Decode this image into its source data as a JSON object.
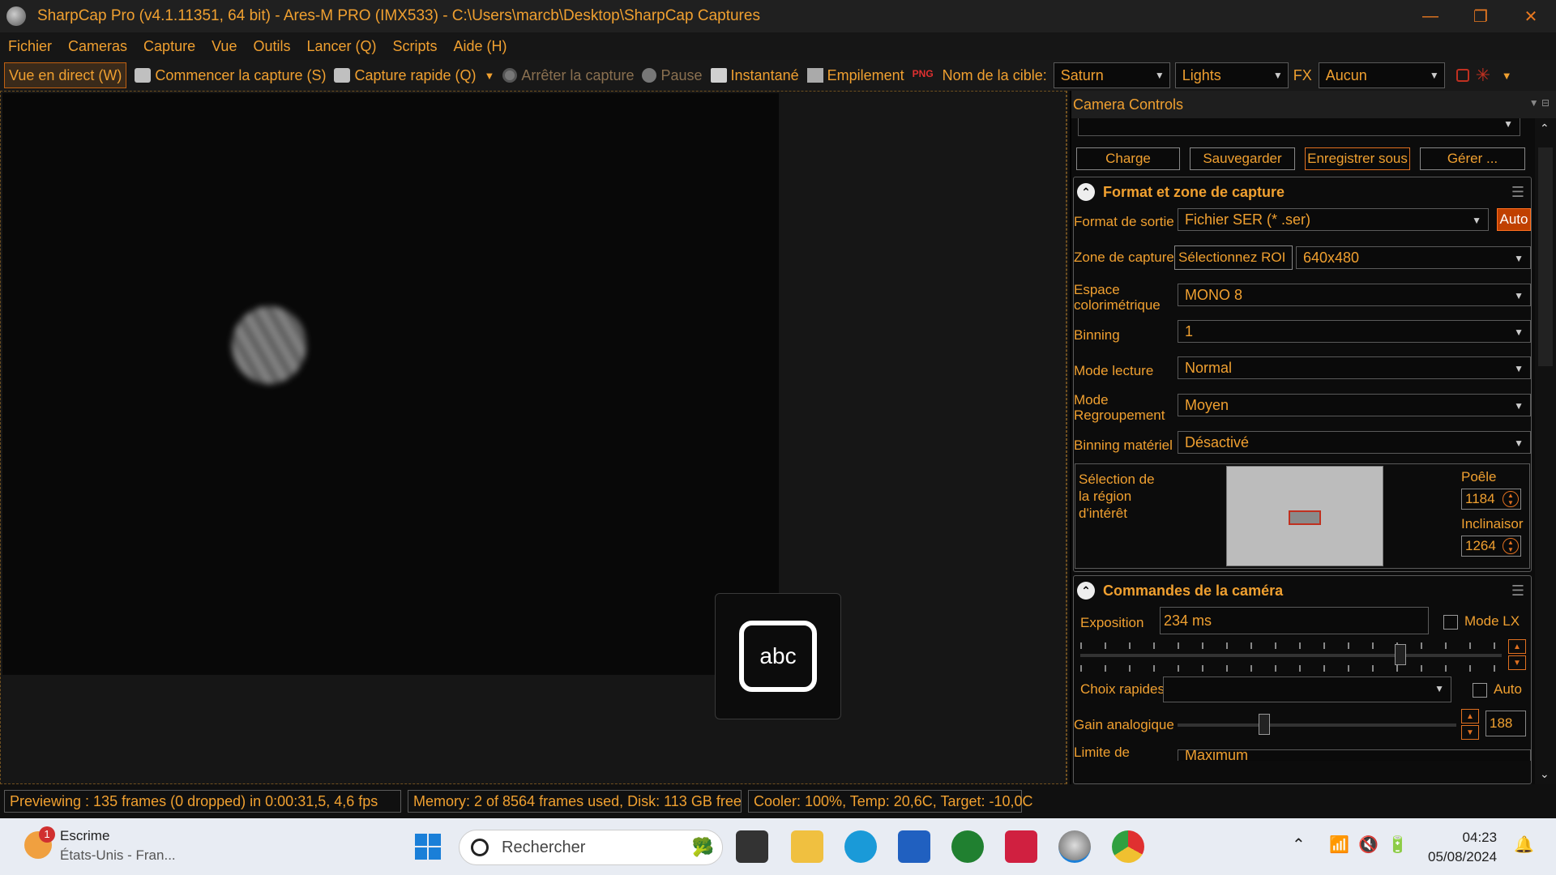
{
  "window": {
    "title": "SharpCap Pro (v4.1.11351, 64 bit) - Ares-M PRO (IMX533) - C:\\Users\\marcb\\Desktop\\SharpCap Captures",
    "controls": {
      "minimize": "—",
      "restore": "❐",
      "close": "✕"
    }
  },
  "menu": [
    "Fichier",
    "Cameras",
    "Capture",
    "Vue",
    "Outils",
    "Lancer (Q)",
    "Scripts",
    "Aide (H)"
  ],
  "toolbar": {
    "live_view": "Vue en direct (W)",
    "start_capture": "Commencer la capture (S)",
    "quick_capture": "Capture rapide (Q)",
    "stop_capture": "Arrêter la capture",
    "pause": "Pause",
    "snapshot": "Instantané",
    "stacking": "Empilement",
    "png_label": "PNG",
    "target_label": "Nom de la cible:",
    "target_value": "Saturn",
    "frame_type": "Lights",
    "fx_label": "FX",
    "fx_value": "Aucun"
  },
  "camera_controls": {
    "header": "Camera Controls",
    "buttons": {
      "load": "Charge",
      "save": "Sauvegarder",
      "save_as": "Enregistrer sous",
      "manage": "Gérer ..."
    },
    "format_section": {
      "title": "Format et zone de capture",
      "output_format_label": "Format de sortie",
      "output_format_value": "Fichier SER (* .ser)",
      "auto_label": "Auto",
      "capture_area_label": "Zone de capture",
      "roi_button": "Sélectionnez ROI",
      "capture_area_value": "640x480",
      "color_space_label": "Espace colorimétrique",
      "color_space_value": "MONO 8",
      "binning_label": "Binning",
      "binning_value": "1",
      "read_mode_label": "Mode lecture",
      "read_mode_value": "Normal",
      "grouping_mode_label": "Mode Regroupement",
      "grouping_mode_value": "Moyen",
      "hw_binning_label": "Binning matériel",
      "hw_binning_value": "Désactivé",
      "roi_selection_label": "Sélection de la région d'intérêt",
      "pan_label": "Poêle",
      "pan_value": "1184",
      "tilt_label": "Inclinaisor",
      "tilt_value": "1264"
    },
    "camera_section": {
      "title": "Commandes de la caméra",
      "exposure_label": "Exposition",
      "exposure_value": "234 ms",
      "lx_mode_label": "Mode LX",
      "exposure_slider_fraction": 0.76,
      "quick_choice_label": "Choix rapides",
      "quick_choice_value": "",
      "auto_label": "Auto",
      "gain_label": "Gain analogique",
      "gain_value": "188",
      "gain_slider_fraction": 0.31,
      "rate_limit_label": "Limite de fréquence",
      "rate_limit_value": "Maximum"
    }
  },
  "status": {
    "preview": "Previewing : 135 frames (0 dropped) in 0:00:31,5, 4,6 fps",
    "memory": "Memory: 2 of 8564 frames used, Disk: 113 GB free",
    "cooler": "Cooler: 100%, Temp: 20,6C, Target: -10,0C"
  },
  "keyboard_overlay": {
    "text": "abc"
  },
  "taskbar": {
    "weather_badge": "1",
    "weather_title": "Escrime",
    "weather_sub": "États-Unis - Fran...",
    "search_placeholder": "Rechercher",
    "time": "04:23",
    "date": "05/08/2024"
  }
}
